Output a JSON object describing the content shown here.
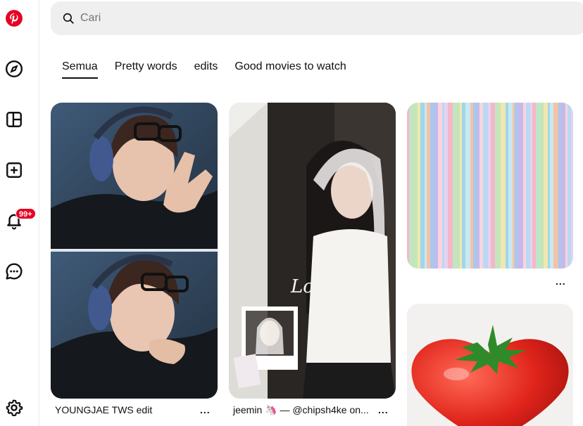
{
  "colors": {
    "brand": "#e60023",
    "search_bg": "#efefef",
    "text": "#111111"
  },
  "sidebar": {
    "items": [
      {
        "icon": "pinterest-logo-icon"
      },
      {
        "icon": "compass-explore-icon"
      },
      {
        "icon": "board-layout-icon"
      },
      {
        "icon": "create-plus-icon"
      },
      {
        "icon": "notifications-bell-icon",
        "badge": "99+"
      },
      {
        "icon": "messages-chat-icon"
      },
      {
        "icon": "settings-gear-icon"
      }
    ]
  },
  "search": {
    "placeholder": "Cari"
  },
  "tabs": [
    {
      "label": "Semua",
      "active": true
    },
    {
      "label": "Pretty words"
    },
    {
      "label": "edits"
    },
    {
      "label": "Good movies to watch"
    }
  ],
  "pins": [
    {
      "title": "YOUNGJAE TWS edit",
      "more": "..."
    },
    {
      "title": "jeemin 🦄 — @chipsh4ke on...",
      "more": "..."
    },
    {
      "title": "",
      "more": "..."
    },
    {
      "title": ""
    }
  ]
}
